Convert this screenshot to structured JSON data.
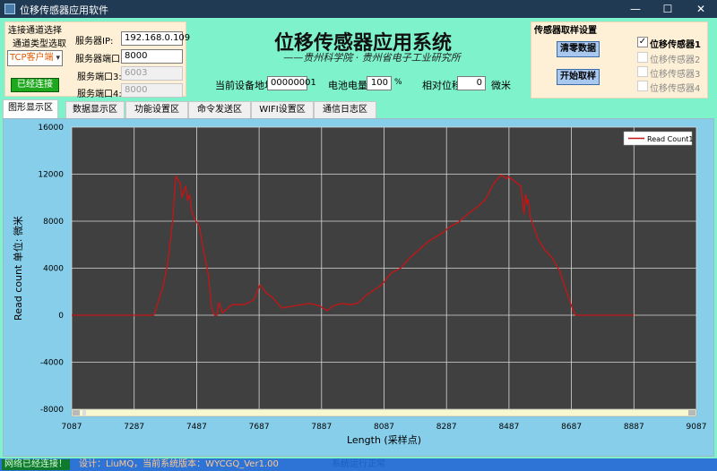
{
  "window": {
    "title": "位移传感器应用软件",
    "controls": [
      "—",
      "☐",
      "✕"
    ]
  },
  "connection": {
    "panel_title": "连接通道选择",
    "channel_type_label": "通道类型选取",
    "channel_type_value": "TCP客户端",
    "connect_button": "已经连接",
    "server_ip_label": "服务器IP:",
    "server_ip_value": "192.168.0.109",
    "port1_label": "服务器端口:",
    "port1_value": "8000",
    "port3_label": "服务端口3:",
    "port3_value": "6003",
    "port4_label": "服务端口4:",
    "port4_value": "8000"
  },
  "header": {
    "title": "位移传感器应用系统",
    "subtitle": "——贵州科学院 · 贵州省电子工业研究所"
  },
  "status": {
    "device_addr_label": "当前设备地址:",
    "device_addr_value": "00000001",
    "battery_label": "电池电量:",
    "battery_value": "100",
    "battery_unit": "%",
    "displacement_label": "相对位移:",
    "displacement_value": "0",
    "displacement_unit": "微米"
  },
  "sensor_panel": {
    "title": "传感器取样设置",
    "clear_button": "清零数据",
    "start_button": "开始取样",
    "sensors": [
      {
        "label": "位移传感器1",
        "checked": true
      },
      {
        "label": "位移传感器2",
        "checked": false
      },
      {
        "label": "位移传感器3",
        "checked": false
      },
      {
        "label": "位移传感器4",
        "checked": false
      }
    ]
  },
  "tabs": [
    "图形显示区",
    "数据显示区",
    "功能设置区",
    "命令发送区",
    "WIFI设置区",
    "通信日志区"
  ],
  "bottom": {
    "net_status": "网络已经连接！",
    "design_info": "设计：LiuMQ，当前系统版本：WYCGQ_Ver1.00",
    "sys_status": "系统运行正常"
  },
  "chart_data": {
    "type": "line",
    "title": "",
    "xlabel": "Length (采样点)",
    "ylabel": "Read count 单位: 微米",
    "xlim": [
      7087,
      9087
    ],
    "ylim": [
      -8000,
      16000
    ],
    "x_ticks": [
      7087,
      7287,
      7487,
      7687,
      7887,
      8087,
      8287,
      8487,
      8687,
      8887,
      9087
    ],
    "y_ticks": [
      -8000,
      -4000,
      0,
      4000,
      8000,
      12000,
      16000
    ],
    "grid": true,
    "legend": "top-right",
    "colors": {
      "plot_bg": "#404040",
      "grid": "#d8d8d8",
      "series": "#c81414"
    },
    "series": [
      {
        "name": "Read Count1",
        "x": [
          7087,
          7350,
          7380,
          7395,
          7410,
          7420,
          7435,
          7440,
          7452,
          7458,
          7465,
          7470,
          7480,
          7495,
          7510,
          7525,
          7535,
          7545,
          7552,
          7558,
          7570,
          7600,
          7640,
          7670,
          7690,
          7710,
          7730,
          7760,
          7800,
          7850,
          7880,
          7905,
          7925,
          7950,
          7980,
          8000,
          8010,
          8030,
          8080,
          8110,
          8140,
          8170,
          8200,
          8230,
          8255,
          8275,
          8295,
          8325,
          8355,
          8385,
          8410,
          8440,
          8455,
          8460,
          8470,
          8480,
          8485,
          8495,
          8525,
          8535,
          8540,
          8545,
          8548,
          8555,
          8565,
          8580,
          8600,
          8625,
          8650,
          8670,
          8690,
          8700,
          8715,
          8740,
          8780,
          8800,
          8887
        ],
        "y": [
          0,
          0,
          2500,
          4500,
          8000,
          11800,
          11200,
          10000,
          11000,
          9800,
          10200,
          9000,
          8200,
          7600,
          5400,
          3400,
          600,
          0,
          0,
          1100,
          200,
          900,
          900,
          1300,
          2600,
          1900,
          1500,
          600,
          800,
          1000,
          800,
          400,
          800,
          1000,
          900,
          1000,
          1200,
          1700,
          2600,
          3600,
          4000,
          4900,
          5600,
          6300,
          6700,
          7000,
          7500,
          7900,
          8600,
          9200,
          9800,
          11300,
          11700,
          11900,
          11800,
          11600,
          11800,
          11600,
          11000,
          8600,
          10300,
          9400,
          9900,
          8400,
          7600,
          6500,
          5600,
          4900,
          3700,
          2100,
          600,
          0,
          0,
          0,
          0,
          0,
          0
        ]
      }
    ]
  }
}
